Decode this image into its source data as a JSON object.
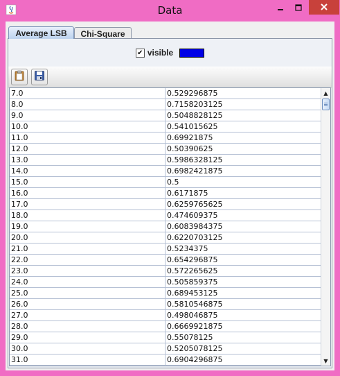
{
  "window": {
    "title": "Data"
  },
  "tabs": [
    {
      "label": "Average LSB",
      "selected": true
    },
    {
      "label": "Chi-Square",
      "selected": false
    }
  ],
  "visible_toggle": {
    "label": "visible",
    "checked": true,
    "check_glyph": "✔",
    "color": "#0000e6"
  },
  "toolbar": {
    "buttons": [
      "paste-icon",
      "save-icon"
    ]
  },
  "table": {
    "rows": [
      [
        "7.0",
        "0.529296875"
      ],
      [
        "8.0",
        "0.7158203125"
      ],
      [
        "9.0",
        "0.5048828125"
      ],
      [
        "10.0",
        "0.541015625"
      ],
      [
        "11.0",
        "0.69921875"
      ],
      [
        "12.0",
        "0.50390625"
      ],
      [
        "13.0",
        "0.5986328125"
      ],
      [
        "14.0",
        "0.6982421875"
      ],
      [
        "15.0",
        "0.5"
      ],
      [
        "16.0",
        "0.6171875"
      ],
      [
        "17.0",
        "0.6259765625"
      ],
      [
        "18.0",
        "0.474609375"
      ],
      [
        "19.0",
        "0.6083984375"
      ],
      [
        "20.0",
        "0.6220703125"
      ],
      [
        "21.0",
        "0.5234375"
      ],
      [
        "22.0",
        "0.654296875"
      ],
      [
        "23.0",
        "0.572265625"
      ],
      [
        "24.0",
        "0.505859375"
      ],
      [
        "25.0",
        "0.689453125"
      ],
      [
        "26.0",
        "0.5810546875"
      ],
      [
        "27.0",
        "0.498046875"
      ],
      [
        "28.0",
        "0.6669921875"
      ],
      [
        "29.0",
        "0.55078125"
      ],
      [
        "30.0",
        "0.5205078125"
      ],
      [
        "31.0",
        "0.6904296875"
      ]
    ]
  }
}
